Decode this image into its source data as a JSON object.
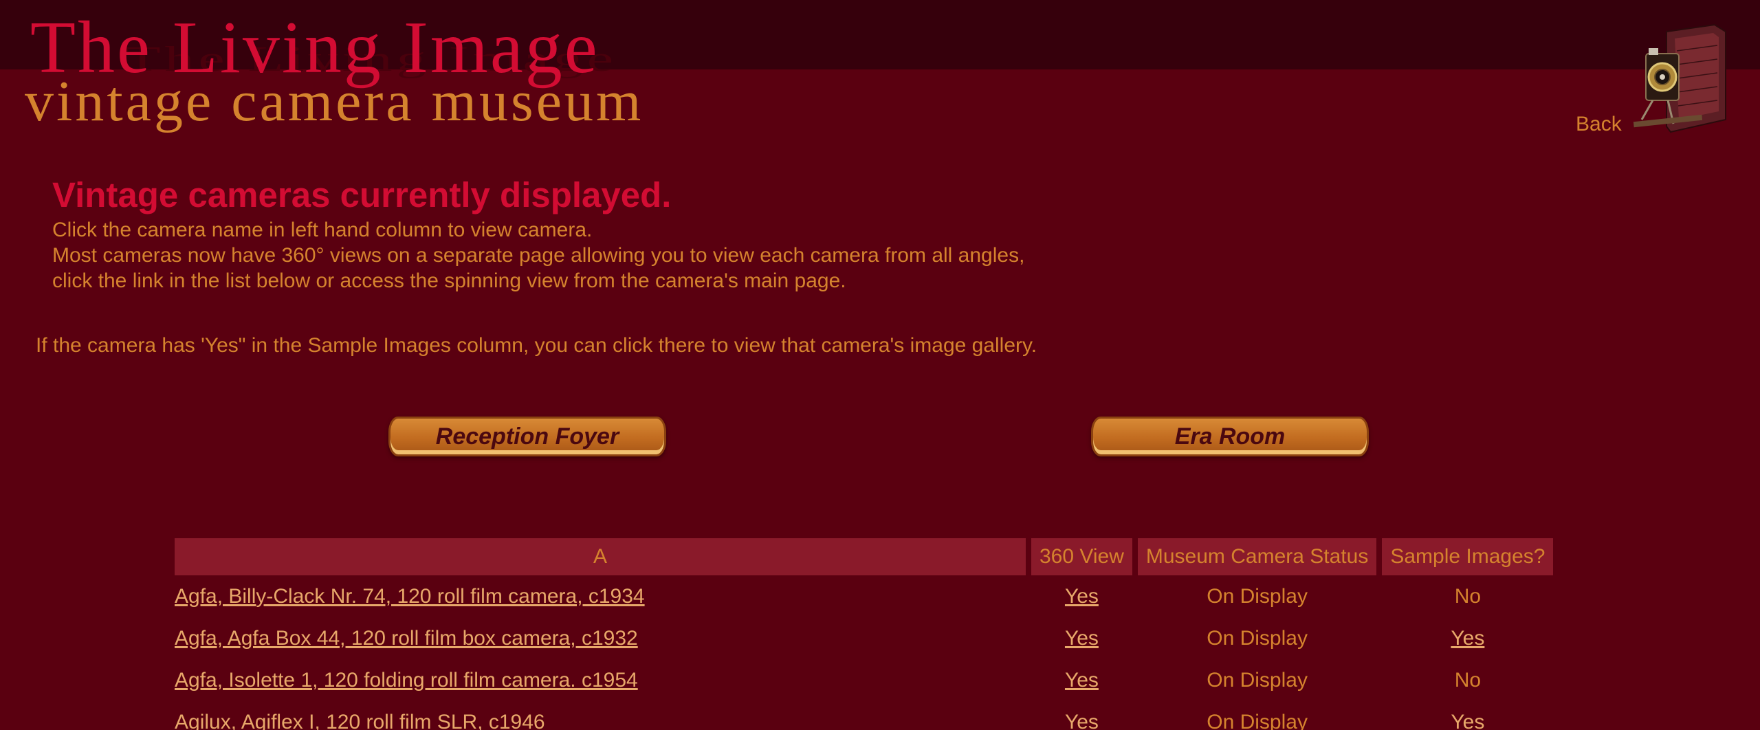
{
  "header": {
    "logo_title": "The Living Image",
    "logo_subtitle": "vintage camera museum",
    "back_label": "Back",
    "camera_icon": "vintage-folding-camera-icon"
  },
  "intro": {
    "heading": "Vintage cameras currently displayed.",
    "line1": "Click the camera name in left hand column to view camera.",
    "line2": "Most cameras now have 360° views on a separate page allowing you to view each camera from all angles,",
    "line3": "click the link in the list below or access the spinning view from the camera's main page.",
    "sample_note": "If the camera has 'Yes\" in the Sample Images column, you can click there to view that camera's image gallery."
  },
  "rooms": {
    "foyer_label": "Reception Foyer",
    "era_label": "Era Room"
  },
  "table": {
    "headers": [
      "A",
      "360 View",
      "Museum Camera Status",
      "Sample Images?"
    ],
    "rows": [
      {
        "name": "Agfa, Billy-Clack Nr. 74, 120 roll film camera, c1934",
        "view": "Yes",
        "status": "On Display",
        "samples": "No",
        "samples_link": false
      },
      {
        "name": "Agfa, Agfa Box 44, 120 roll film box camera, c1932",
        "view": "Yes",
        "status": "On Display",
        "samples": "Yes",
        "samples_link": true
      },
      {
        "name": "Agfa, Isolette 1, 120 folding roll film camera. c1954",
        "view": "Yes",
        "status": "On Display",
        "samples": "No",
        "samples_link": false
      },
      {
        "name": "Agilux, Agiflex I, 120 roll film SLR, c1946",
        "view": "Yes",
        "status": "On Display",
        "samples": "Yes",
        "samples_link": true
      }
    ]
  },
  "colors": {
    "background": "#5a0010",
    "header_band": "#36000c",
    "accent_red": "#d30c33",
    "accent_orange": "#d5832e",
    "table_header": "#8a1a2a"
  }
}
